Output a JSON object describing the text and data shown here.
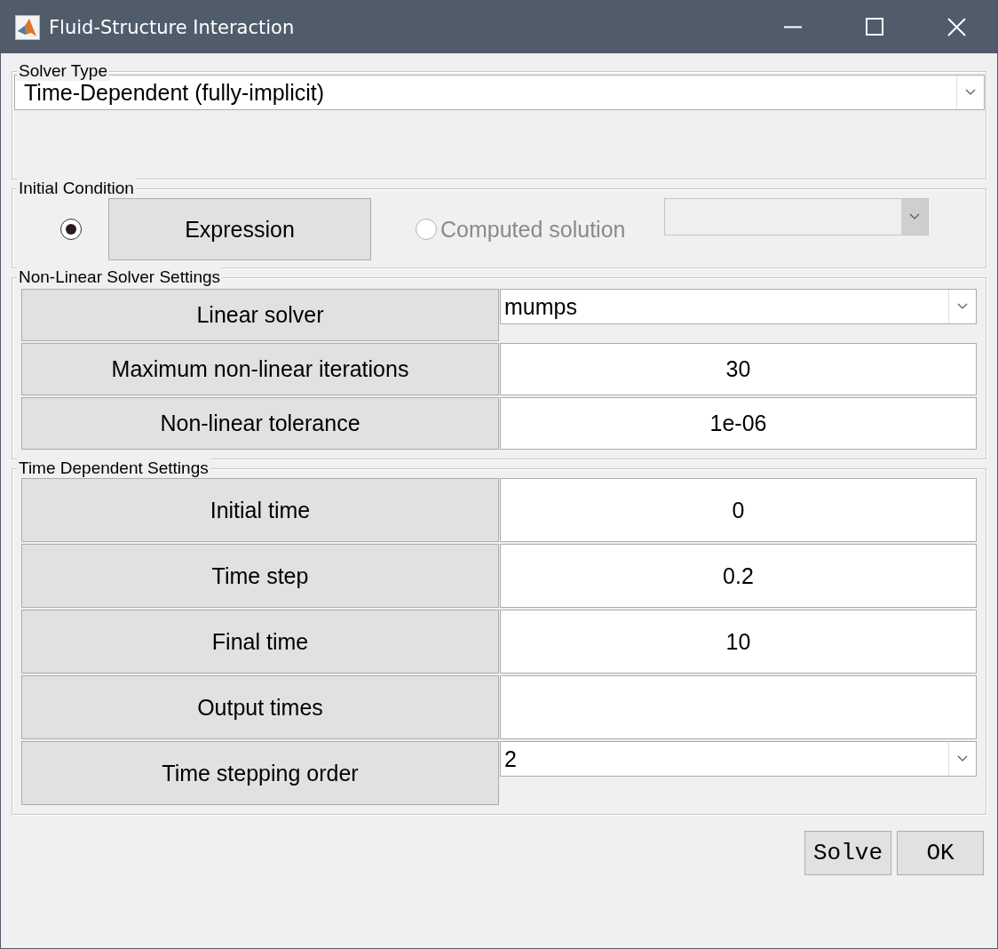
{
  "window": {
    "title": "Fluid-Structure Interaction"
  },
  "solver_type": {
    "label": "Solver Type",
    "value": "Time-Dependent (fully-implicit)"
  },
  "initial_condition": {
    "label": "Initial Condition",
    "expression_radio": {
      "selected": true
    },
    "expression_button": "Expression",
    "computed_radio": {
      "label": "Computed solution",
      "selected": false,
      "disabled": true
    },
    "solution_dropdown": {
      "disabled": true
    }
  },
  "nonlinear_settings": {
    "label": "Non-Linear Solver Settings",
    "rows": [
      {
        "label": "Linear solver",
        "kind": "dropdown",
        "value": "mumps"
      },
      {
        "label": "Maximum non-linear iterations",
        "kind": "field",
        "value": "30"
      },
      {
        "label": "Non-linear tolerance",
        "kind": "field",
        "value": "1e-06"
      }
    ]
  },
  "time_settings": {
    "label": "Time Dependent Settings",
    "rows": [
      {
        "label": "Initial time",
        "kind": "field",
        "value": "0"
      },
      {
        "label": "Time step",
        "kind": "field",
        "value": "0.2"
      },
      {
        "label": "Final time",
        "kind": "field",
        "value": "10"
      },
      {
        "label": "Output times",
        "kind": "field",
        "value": ""
      },
      {
        "label": "Time stepping order",
        "kind": "dropdown",
        "value": "2"
      }
    ]
  },
  "buttons": [
    "Solve",
    "OK"
  ]
}
